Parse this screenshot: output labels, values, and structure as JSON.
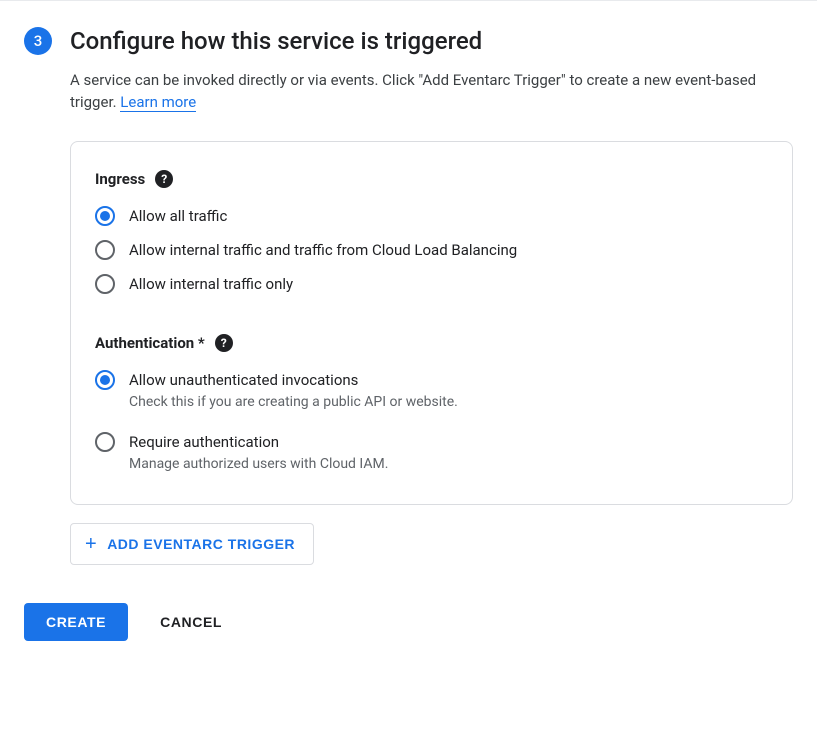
{
  "step": {
    "number": "3",
    "title": "Configure how this service is triggered",
    "description_prefix": "A service can be invoked directly or via events. Click \"Add Eventarc Trigger\" to create a new event-based trigger. ",
    "learn_more_label": "Learn more"
  },
  "ingress": {
    "label": "Ingress",
    "options": [
      {
        "label": "Allow all traffic",
        "selected": true
      },
      {
        "label": "Allow internal traffic and traffic from Cloud Load Balancing",
        "selected": false
      },
      {
        "label": "Allow internal traffic only",
        "selected": false
      }
    ]
  },
  "authentication": {
    "label": "Authentication *",
    "options": [
      {
        "label": "Allow unauthenticated invocations",
        "helper": "Check this if you are creating a public API or website.",
        "selected": true
      },
      {
        "label": "Require authentication",
        "helper": "Manage authorized users with Cloud IAM.",
        "selected": false
      }
    ]
  },
  "add_trigger": {
    "label": "ADD EVENTARC TRIGGER"
  },
  "footer": {
    "create_label": "CREATE",
    "cancel_label": "CANCEL"
  },
  "icons": {
    "help": "?",
    "plus": "+"
  }
}
